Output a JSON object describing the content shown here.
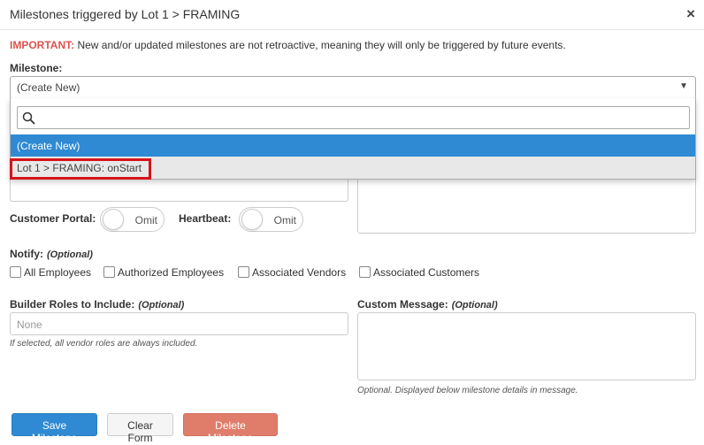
{
  "modal": {
    "title": "Milestones triggered by Lot 1 > FRAMING",
    "close": "×"
  },
  "notice": {
    "important": "IMPORTANT:",
    "text": " New and/or updated milestones are not retroactive, meaning they will only be triggered by future events."
  },
  "milestone": {
    "label": "Milestone:",
    "selected": "(Create New)",
    "arrow_icon": "caret-down-icon",
    "search_icon": "search-icon",
    "search_value": "",
    "options": [
      {
        "label": "(Create New)",
        "highlighted": true
      },
      {
        "label": "Lot 1 > FRAMING: onStart",
        "highlighted": false
      }
    ]
  },
  "toggles": {
    "customer_portal": {
      "label": "Customer Portal:",
      "state": "Omit"
    },
    "heartbeat": {
      "label": "Heartbeat:",
      "state": "Omit"
    }
  },
  "notify": {
    "label": "Notify:",
    "optional": "(Optional)",
    "options": [
      "All Employees",
      "Authorized Employees",
      "Associated Vendors",
      "Associated Customers"
    ]
  },
  "builder_roles": {
    "label": "Builder Roles to Include:",
    "optional": "(Optional)",
    "placeholder": "None",
    "hint": "If selected, all vendor roles are always included."
  },
  "custom_message": {
    "label": "Custom Message:",
    "optional": "(Optional)",
    "hint": "Optional. Displayed below milestone details in message."
  },
  "buttons": {
    "save": "Save Milestone",
    "clear": "Clear Form",
    "delete": "Delete Milestone"
  },
  "colors": {
    "primary": "#2f8ad3",
    "danger_text": "#d9534f",
    "delete_button": "#df7d6a",
    "highlight_outline": "#d6131b"
  }
}
